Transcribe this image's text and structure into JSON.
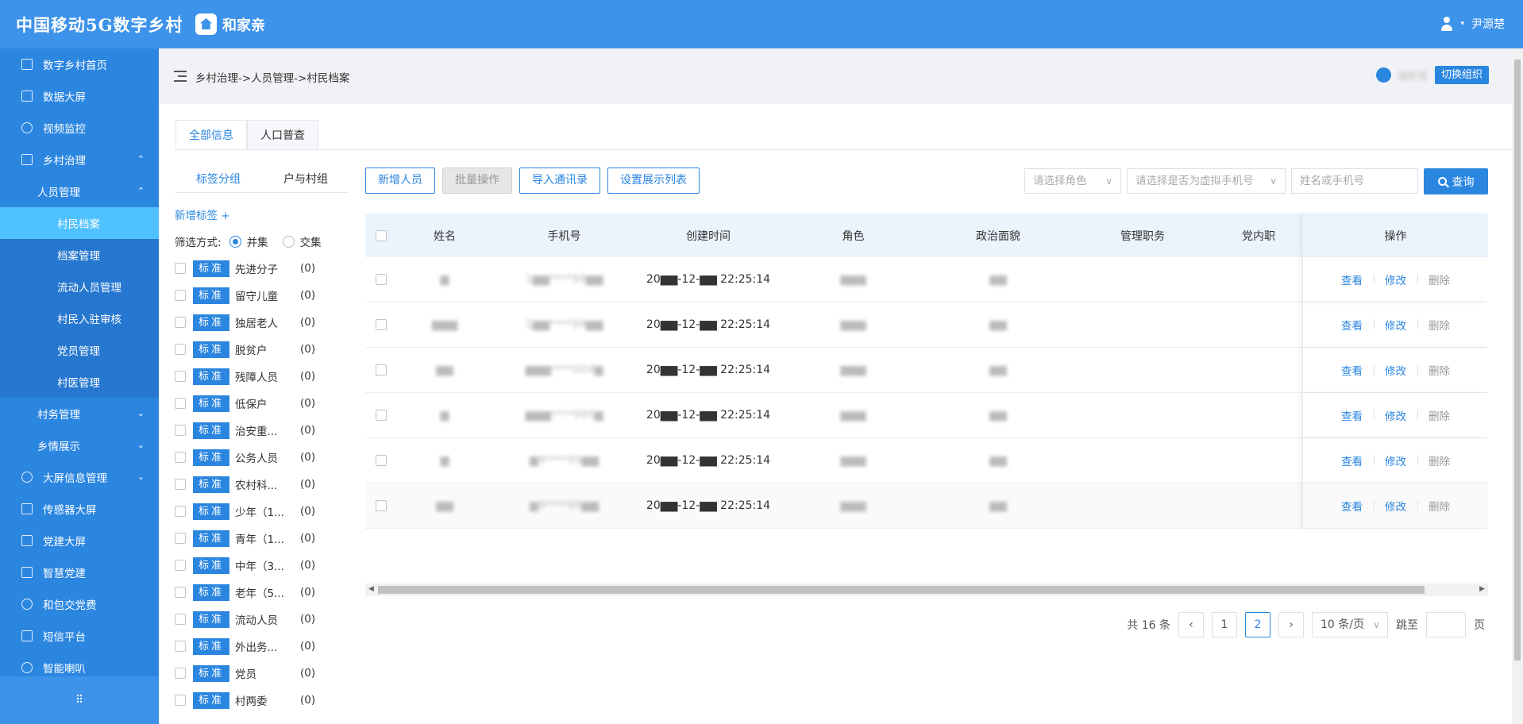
{
  "header": {
    "brand": "中国移动5G数字乡村",
    "app_name": "和家亲",
    "user_name": "尹源楚",
    "user_caret": "▾"
  },
  "sidebar": {
    "items": [
      {
        "label": "数字乡村首页",
        "icon": "home-icon"
      },
      {
        "label": "数据大屏",
        "icon": "doc-icon"
      },
      {
        "label": "视频监控",
        "icon": "camera-icon"
      },
      {
        "label": "乡村治理",
        "icon": "chart-icon",
        "arrow": "⌃"
      },
      {
        "label": "人员管理",
        "arrow": "⌃"
      },
      {
        "label": "村民档案"
      },
      {
        "label": "档案管理"
      },
      {
        "label": "流动人员管理"
      },
      {
        "label": "村民入驻审核"
      },
      {
        "label": "党员管理"
      },
      {
        "label": "村医管理"
      },
      {
        "label": "村务管理",
        "arrow": "⌄"
      },
      {
        "label": "乡情展示",
        "arrow": "⌄"
      },
      {
        "label": "大屏信息管理",
        "icon": "bell-icon",
        "arrow": "⌄"
      },
      {
        "label": "传感器大屏",
        "icon": "doc-icon"
      },
      {
        "label": "党建大屏",
        "icon": "home-icon"
      },
      {
        "label": "智慧党建",
        "icon": "doc-icon"
      },
      {
        "label": "和包交党费",
        "icon": "camera-icon"
      },
      {
        "label": "短信平台",
        "icon": "chart-icon"
      },
      {
        "label": "智能喇叭",
        "icon": "bell-icon"
      }
    ],
    "footer_glyph": "⠿"
  },
  "breadcrumb": "乡村治理->人员管理->村民档案",
  "org": {
    "name": "组织名",
    "switch_label": "切换组织"
  },
  "tabs": [
    {
      "label": "全部信息"
    },
    {
      "label": "人口普查"
    }
  ],
  "subtabs": [
    {
      "label": "标签分组"
    },
    {
      "label": "户与村组"
    }
  ],
  "add_tag_label": "新增标签 +",
  "filter": {
    "label": "筛选方式:",
    "option1": "并集",
    "option2": "交集"
  },
  "tag_badge": "标准",
  "tags": [
    {
      "name": "先进分子",
      "count": "(0)"
    },
    {
      "name": "留守儿童",
      "count": "(0)"
    },
    {
      "name": "独居老人",
      "count": "(0)"
    },
    {
      "name": "脱贫户",
      "count": "(0)"
    },
    {
      "name": "残障人员",
      "count": "(0)"
    },
    {
      "name": "低保户",
      "count": "(0)"
    },
    {
      "name": "治安重...",
      "count": "(0)"
    },
    {
      "name": "公务人员",
      "count": "(0)"
    },
    {
      "name": "农村科...",
      "count": "(0)"
    },
    {
      "name": "少年（1...",
      "count": "(0)"
    },
    {
      "name": "青年（1...",
      "count": "(0)"
    },
    {
      "name": "中年（3...",
      "count": "(0)"
    },
    {
      "name": "老年（5...",
      "count": "(0)"
    },
    {
      "name": "流动人员",
      "count": "(0)"
    },
    {
      "name": "外出务...",
      "count": "(0)"
    },
    {
      "name": "党员",
      "count": "(0)"
    },
    {
      "name": "村两委",
      "count": "(0)"
    }
  ],
  "toolbar": {
    "add_person": "新增人员",
    "batch": "批量操作",
    "import_contacts": "导入通讯录",
    "set_columns": "设置展示列表"
  },
  "search": {
    "role_placeholder": "请选择角色",
    "virtual_placeholder": "请选择是否为虚拟手机号",
    "name_placeholder": "姓名或手机号",
    "query_label": "查询"
  },
  "table": {
    "columns": [
      "姓名",
      "手机号",
      "创建时间",
      "角色",
      "政治面貌",
      "管理职务",
      "党内职",
      "操作"
    ],
    "actions": {
      "view": "查看",
      "edit": "修改",
      "delete": "删除"
    },
    "rows": [
      {
        "name": "▆",
        "phone": "1▆▆****99▆▆",
        "time": "20▆▆-12-▆▆ 22:25:14",
        "role": "▆▆▆",
        "political": "▆▆"
      },
      {
        "name": "▆▆▆",
        "phone": "1▆▆****99▆▆",
        "time": "20▆▆-12-▆▆ 22:25:14",
        "role": "▆▆▆",
        "political": "▆▆"
      },
      {
        "name": "▆▆",
        "phone": "▆▆▆****004▆",
        "time": "20▆▆-12-▆▆ 22:25:14",
        "role": "▆▆▆",
        "political": "▆▆"
      },
      {
        "name": "▆",
        "phone": "▆▆▆****995▆",
        "time": "20▆▆-12-▆▆ 22:25:14",
        "role": "▆▆▆",
        "political": "▆▆"
      },
      {
        "name": "▆",
        "phone": "▆9****99▆▆",
        "time": "20▆▆-12-▆▆ 22:25:14",
        "role": "▆▆▆",
        "political": "▆▆"
      },
      {
        "name": "▆▆",
        "phone": "▆9****99▆▆",
        "time": "20▆▆-12-▆▆ 22:25:14",
        "role": "▆▆▆",
        "political": "▆▆"
      }
    ]
  },
  "pagination": {
    "total": "共 16 条",
    "prev": "‹",
    "pages": [
      "1",
      "2"
    ],
    "next": "›",
    "page_size": "10 条/页",
    "jump_label": "跳至",
    "page_unit": "页"
  },
  "colors": {
    "primary": "#2b86e0",
    "header": "#3d93ea",
    "active_menu": "#4fc1ff"
  }
}
